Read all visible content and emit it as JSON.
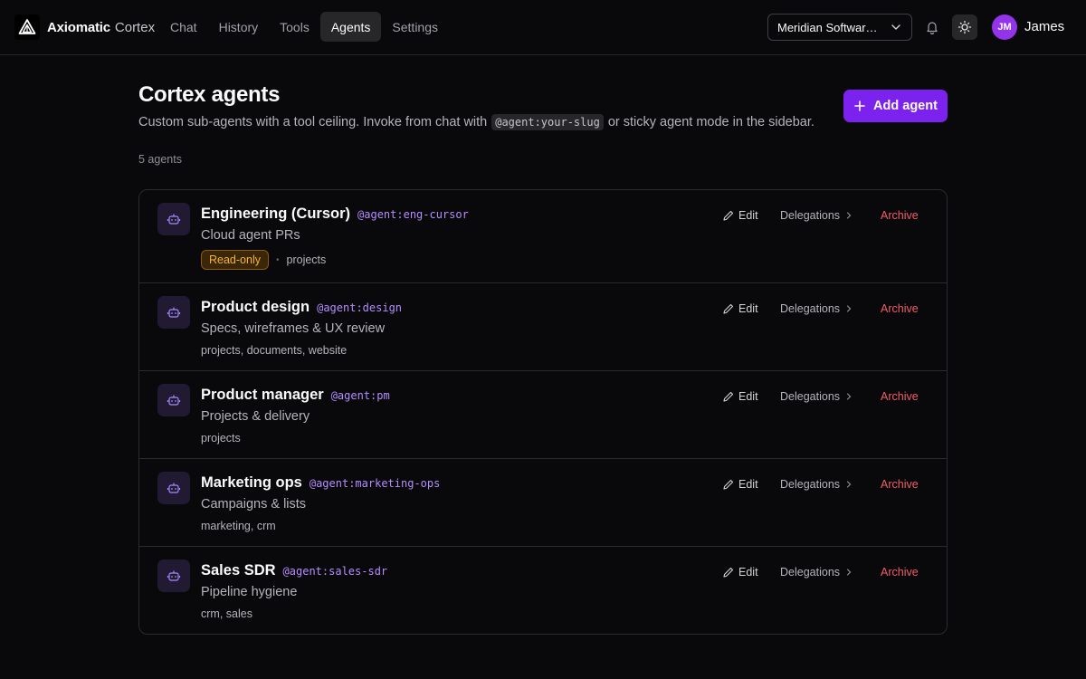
{
  "brand": {
    "name_primary": "Axiomatic",
    "name_secondary": "Cortex"
  },
  "nav": [
    {
      "label": "Chat",
      "active": false
    },
    {
      "label": "History",
      "active": false
    },
    {
      "label": "Tools",
      "active": false
    },
    {
      "label": "Agents",
      "active": true
    },
    {
      "label": "Settings",
      "active": false
    }
  ],
  "org_selector": {
    "value": "Meridian Software Inc."
  },
  "user": {
    "initials": "JM",
    "name": "James",
    "avatar_color": "#9333ea"
  },
  "page": {
    "title": "Cortex agents",
    "subtitle_before": "Custom sub-agents with a tool ceiling. Invoke from chat with",
    "subtitle_code": "@agent:your-slug",
    "subtitle_after": "or sticky agent mode in the sidebar.",
    "add_button": "Add agent",
    "count_label": "5 agents"
  },
  "actions": {
    "edit": "Edit",
    "delegations": "Delegations",
    "archive": "Archive"
  },
  "agents": [
    {
      "name": "Engineering (Cursor)",
      "slug": "@agent:eng-cursor",
      "description": "Cloud agent PRs",
      "badge": "Read-only",
      "tools": "projects"
    },
    {
      "name": "Product design",
      "slug": "@agent:design",
      "description": "Specs, wireframes & UX review",
      "badge": "",
      "tools": "projects, documents, website"
    },
    {
      "name": "Product manager",
      "slug": "@agent:pm",
      "description": "Projects & delivery",
      "badge": "",
      "tools": "projects"
    },
    {
      "name": "Marketing ops",
      "slug": "@agent:marketing-ops",
      "description": "Campaigns & lists",
      "badge": "",
      "tools": "marketing, crm"
    },
    {
      "name": "Sales SDR",
      "slug": "@agent:sales-sdr",
      "description": "Pipeline hygiene",
      "badge": "",
      "tools": "crm, sales"
    }
  ],
  "colors": {
    "accent": "#7c22ef",
    "slug": "#b58cff",
    "archive": "#f25c67",
    "badge_text": "#f5b437"
  },
  "icons": [
    "logo-icon",
    "chevron-down-icon",
    "bell-icon",
    "sun-icon",
    "plus-icon",
    "robot-icon",
    "pencil-icon",
    "chevron-right-icon"
  ]
}
